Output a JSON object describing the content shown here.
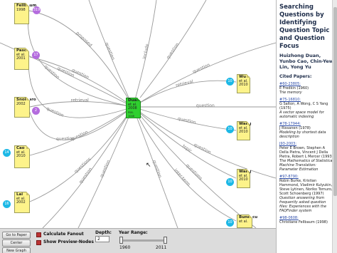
{
  "graph": {
    "center": {
      "name": "Duan",
      "meta": "et al.",
      "year": "2008",
      "id": "P08-1048"
    },
    "papers": [
      {
        "key": "fellbaum",
        "name": "Fellbaum",
        "year": "1998",
        "badge": "319",
        "badge_color": "purple"
      },
      {
        "key": "pasca",
        "name": "Pasca",
        "meta": "et al.",
        "year": "2001",
        "badge": "17",
        "badge_color": "purple"
      },
      {
        "key": "snoidaro",
        "name": "Snoidaro",
        "year": "2002",
        "badge": "2",
        "badge_color": "purple"
      },
      {
        "key": "cao",
        "name": "Cao",
        "meta": "et al.",
        "year": "2010",
        "badge": "14",
        "badge_color": "cyan"
      },
      {
        "key": "lai",
        "name": "Lai",
        "meta": "et al.",
        "year": "2002",
        "badge": "16",
        "badge_color": "cyan"
      },
      {
        "key": "wu",
        "name": "Wu",
        "meta": "et al.",
        "year": "2010",
        "badge": "10",
        "badge_color": "cyan"
      },
      {
        "key": "wang1",
        "name": "Wang",
        "meta": "et al.",
        "year": "2010",
        "badge": "10",
        "badge_color": "cyan"
      },
      {
        "key": "wang2",
        "name": "Wang",
        "meta": "et al.",
        "year": "2010",
        "badge": "10",
        "badge_color": "cyan"
      },
      {
        "key": "bunescu",
        "name": "Bunescu",
        "meta": "et al.",
        "year": "2010",
        "badge": "10",
        "badge_color": "cyan"
      }
    ],
    "edge_labels": [
      "proposed",
      "question",
      "retrieval",
      "question",
      "questions",
      "question",
      "question",
      "question",
      "retrieval",
      "question",
      "topic",
      "inter-term",
      "question",
      "include",
      "question",
      "question",
      "question",
      "question",
      "question",
      "question",
      "question",
      "questions",
      "question"
    ]
  },
  "sidebar": {
    "title": "Searching Questions by Identifying Question Topic and Question Focus",
    "authors": "Huizhong Duan, Yunbo Cao, Chin-Yew Lin, Yong Yu",
    "cited_header": "Cited Papers:",
    "cited": [
      {
        "id": "#60-23805:",
        "authors": "E Fredkin (1960)",
        "title": "Trie memory"
      },
      {
        "id": "#75-16810:",
        "authors": "G Salton, A Wong, C S Yang (1975)",
        "title": "A vector space model for automatic indexing"
      },
      {
        "id": "#78-17944:",
        "authors": "J Rissanen (1978)",
        "title": "Modeling by shortest data description"
      },
      {
        "id": "J93-2003:",
        "authors": "Peter E Brown, Stephen A Della Pietra, Vincent J Della Pietra, Robert L Mercer (1993)",
        "title": "The Mathematics of Statistical Machine Translation: Parameter Estimation"
      },
      {
        "id": "#97-8790:",
        "authors": "Robin Burke, Kristian Hammond, Vladimir Kulyukin, Steve Lytinen, Noriko Tomuro, Scott Schoenberg (1997)",
        "title": "Question answering from frequently asked question files: Experiences with the FAQFinder system"
      },
      {
        "id": "#98-0608:",
        "authors": "Christiane Fellbaum (1998)",
        "title": ""
      }
    ]
  },
  "controls": {
    "buttons": [
      "Go to Paper",
      "Center",
      "New Graph"
    ],
    "calc_fanout": "Calculate Fanout",
    "show_preview": "Show Preview-Nodes",
    "depth_label": "Depth:",
    "depth_value": "2",
    "year_range_label": "Year Range:",
    "year_min": "1960",
    "year_max": "2011",
    "checkbox_color": "#b33333"
  }
}
